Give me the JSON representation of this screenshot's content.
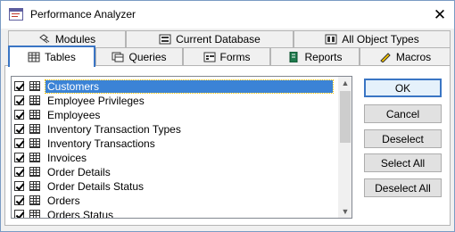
{
  "window": {
    "title": "Performance Analyzer"
  },
  "tabs_row1": [
    {
      "label": "Modules",
      "icon": "modules-icon"
    },
    {
      "label": "Current Database",
      "icon": "database-icon"
    },
    {
      "label": "All Object Types",
      "icon": "all-objects-icon"
    }
  ],
  "tabs_row2": [
    {
      "label": "Tables",
      "icon": "table-icon",
      "active": true
    },
    {
      "label": "Queries",
      "icon": "query-icon"
    },
    {
      "label": "Forms",
      "icon": "form-icon"
    },
    {
      "label": "Reports",
      "icon": "report-icon"
    },
    {
      "label": "Macros",
      "icon": "macro-icon"
    }
  ],
  "list": {
    "items": [
      {
        "label": "Customers",
        "checked": true,
        "selected": true
      },
      {
        "label": "Employee Privileges",
        "checked": true
      },
      {
        "label": "Employees",
        "checked": true
      },
      {
        "label": "Inventory Transaction Types",
        "checked": true
      },
      {
        "label": "Inventory Transactions",
        "checked": true
      },
      {
        "label": "Invoices",
        "checked": true
      },
      {
        "label": "Order Details",
        "checked": true
      },
      {
        "label": "Order Details Status",
        "checked": true
      },
      {
        "label": "Orders",
        "checked": true
      },
      {
        "label": "Orders Status",
        "checked": true
      }
    ]
  },
  "buttons": {
    "ok": "OK",
    "cancel": "Cancel",
    "deselect": "Deselect",
    "select_all": "Select All",
    "deselect_all": "Deselect All"
  },
  "colors": {
    "accent": "#3a75c4",
    "selection": "#3b83d6"
  }
}
